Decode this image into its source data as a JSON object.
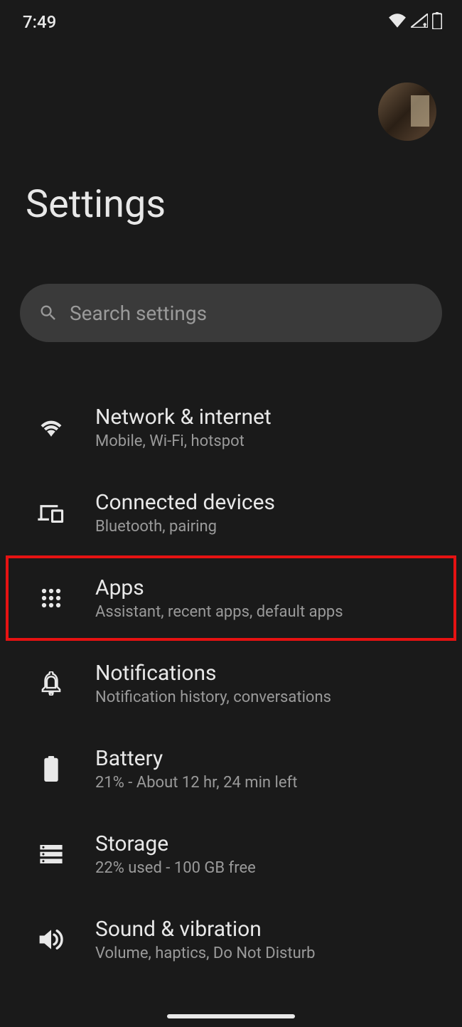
{
  "status_bar": {
    "time": "7:49"
  },
  "header": {
    "title": "Settings"
  },
  "search": {
    "placeholder": "Search settings"
  },
  "settings_items": [
    {
      "title": "Network & internet",
      "subtitle": "Mobile, Wi-Fi, hotspot",
      "icon": "wifi-icon",
      "highlighted": false
    },
    {
      "title": "Connected devices",
      "subtitle": "Bluetooth, pairing",
      "icon": "devices-icon",
      "highlighted": false
    },
    {
      "title": "Apps",
      "subtitle": "Assistant, recent apps, default apps",
      "icon": "apps-icon",
      "highlighted": true
    },
    {
      "title": "Notifications",
      "subtitle": "Notification history, conversations",
      "icon": "bell-icon",
      "highlighted": false
    },
    {
      "title": "Battery",
      "subtitle": "21% - About 12 hr, 24 min left",
      "icon": "battery-icon",
      "highlighted": false
    },
    {
      "title": "Storage",
      "subtitle": "22% used - 100 GB free",
      "icon": "storage-icon",
      "highlighted": false
    },
    {
      "title": "Sound & vibration",
      "subtitle": "Volume, haptics, Do Not Disturb",
      "icon": "sound-icon",
      "highlighted": false
    }
  ]
}
